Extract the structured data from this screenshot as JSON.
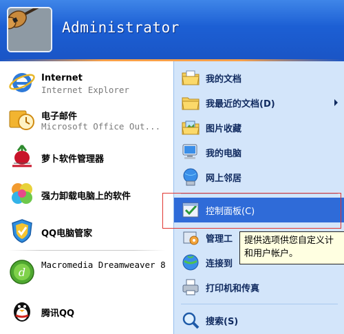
{
  "header": {
    "username": "Administrator"
  },
  "left_items": [
    {
      "title": "Internet",
      "subtitle": "Internet Explorer",
      "icon": "internet-explorer-icon"
    },
    {
      "title": "电子邮件",
      "subtitle": "Microsoft Office Out...",
      "icon": "outlook-email-icon"
    },
    {
      "title": "萝卜软件管理器",
      "icon": "radish-software-manager-icon"
    },
    {
      "title": "强力卸载电脑上的软件",
      "icon": "uninstall-software-icon"
    },
    {
      "title": "QQ电脑管家",
      "icon": "qq-pc-manager-icon"
    },
    {
      "title": "Macromedia Dreamweaver 8",
      "icon": "dreamweaver-icon"
    },
    {
      "title": "腾讯QQ",
      "icon": "qq-penguin-icon"
    }
  ],
  "right_items": [
    {
      "label": "我的文档",
      "icon": "my-documents-icon"
    },
    {
      "label": "我最近的文档(D)",
      "icon": "recent-documents-icon",
      "has_submenu": true
    },
    {
      "label": "图片收藏",
      "icon": "my-pictures-icon"
    },
    {
      "label": "我的电脑",
      "icon": "my-computer-icon"
    },
    {
      "label": "网上邻居",
      "icon": "network-places-icon"
    },
    {
      "label": "控制面板(C)",
      "icon": "control-panel-icon",
      "highlighted": true
    },
    {
      "label": "管理工",
      "icon": "admin-tools-icon"
    },
    {
      "label": "连接到",
      "icon": "connect-to-icon"
    },
    {
      "label": "打印机和传真",
      "icon": "printers-fax-icon"
    },
    {
      "label": "搜索(S)",
      "icon": "search-icon"
    }
  ],
  "tooltip": {
    "line1": "提供选项供您自定义计",
    "line2": "和用户帐户。"
  },
  "colors": {
    "header_blue": "#1c5fd4",
    "highlight_blue": "#2f6bd8",
    "right_pane": "#d3e5fa",
    "orange_accent": "#f7a04a",
    "red_box": "#e0342f",
    "tooltip_bg": "#ffffe1"
  }
}
